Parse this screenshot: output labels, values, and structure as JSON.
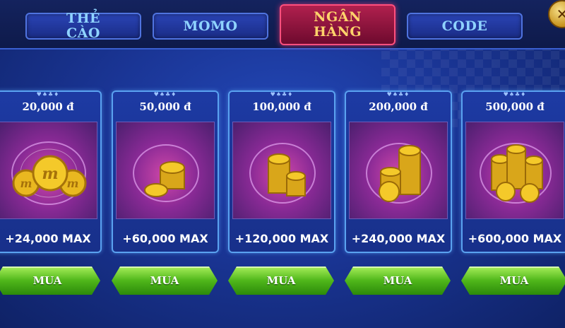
{
  "tabs": [
    {
      "label_line1": "THẺ",
      "label_line2": "CÀO",
      "active": false
    },
    {
      "label_line1": "MOMO",
      "label_line2": "",
      "active": false
    },
    {
      "label_line1": "NGÂN",
      "label_line2": "HÀNG",
      "active": true
    },
    {
      "label_line1": "CODE",
      "label_line2": "",
      "active": false
    }
  ],
  "close_icon": "close-icon",
  "packages": [
    {
      "price": "20,000 đ",
      "bonus": "+24,000 MAX",
      "buy_label": "MUA",
      "art": "coins-large"
    },
    {
      "price": "50,000 đ",
      "bonus": "+60,000 MAX",
      "buy_label": "MUA",
      "art": "coin-stack-small"
    },
    {
      "price": "100,000 đ",
      "bonus": "+120,000 MAX",
      "buy_label": "MUA",
      "art": "coin-stacks-two"
    },
    {
      "price": "200,000 đ",
      "bonus": "+240,000 MAX",
      "buy_label": "MUA",
      "art": "coin-stacks-three"
    },
    {
      "price": "500,000 đ",
      "bonus": "+600,000 MAX",
      "buy_label": "MUA",
      "art": "coin-pile"
    }
  ],
  "colors": {
    "active_tab": "#b0204e",
    "inactive_tab": "#2a44b5",
    "buy_button": "#4fb61a",
    "card_border": "#5aa2f0"
  }
}
